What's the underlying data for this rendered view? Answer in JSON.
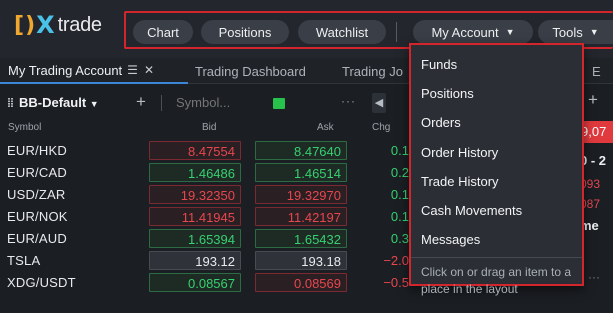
{
  "app": {
    "logo_text": "trade",
    "logo_mark": "DX"
  },
  "nav": {
    "chart": "Chart",
    "positions": "Positions",
    "watchlist": "Watchlist",
    "my_account": "My Account",
    "tools": "Tools",
    "caret": "▼"
  },
  "tabs": {
    "active": "My Trading Account",
    "dashboard": "Trading Dashboard",
    "trading_cut": "Trading Jo",
    "far_cut": "E"
  },
  "watchlist": {
    "name": "BB-Default",
    "symbol_placeholder": "Symbol...",
    "columns": {
      "symbol": "Symbol",
      "bid": "Bid",
      "ask": "Ask",
      "chg": "Chg"
    },
    "rows": [
      {
        "symbol": "EUR/HKD",
        "bid": "8.47554",
        "ask": "8.47640",
        "chg": "0.1",
        "bid_color": "red",
        "ask_color": "green",
        "chg_sign": "pos"
      },
      {
        "symbol": "EUR/CAD",
        "bid": "1.46486",
        "ask": "1.46514",
        "chg": "0.2",
        "bid_color": "green",
        "ask_color": "green",
        "chg_sign": "pos"
      },
      {
        "symbol": "USD/ZAR",
        "bid": "19.32350",
        "ask": "19.32970",
        "chg": "0.1",
        "bid_color": "red",
        "ask_color": "red",
        "chg_sign": "pos"
      },
      {
        "symbol": "EUR/NOK",
        "bid": "11.41945",
        "ask": "11.42197",
        "chg": "0.1",
        "bid_color": "red",
        "ask_color": "red",
        "chg_sign": "pos"
      },
      {
        "symbol": "EUR/AUD",
        "bid": "1.65394",
        "ask": "1.65432",
        "chg": "0.3",
        "bid_color": "green",
        "ask_color": "green",
        "chg_sign": "pos"
      },
      {
        "symbol": "TSLA",
        "bid": "193.12",
        "ask": "193.18",
        "chg": "−2.0",
        "bid_color": "neutral",
        "ask_color": "neutral",
        "chg_sign": "neg"
      },
      {
        "symbol": "XDG/USDT",
        "bid": "0.08567",
        "ask": "0.08569",
        "chg": "−0.5",
        "bid_color": "green",
        "ask_color": "red",
        "chg_sign": "neg"
      }
    ]
  },
  "right_panel": {
    "badge": "9,07",
    "line1": "0 - 2",
    "line2": "093",
    "line3": "087",
    "line4": "me"
  },
  "dropdown": {
    "items": [
      "Funds",
      "Positions",
      "Orders",
      "Order History",
      "Trade History",
      "Cash Movements",
      "Messages"
    ],
    "hint": "Click on or drag an item to a place in the layout"
  },
  "colors": {
    "accent_red": "#d3262c",
    "positive": "#36d170",
    "negative": "#e7474f",
    "active_tab": "#3c86d8"
  }
}
